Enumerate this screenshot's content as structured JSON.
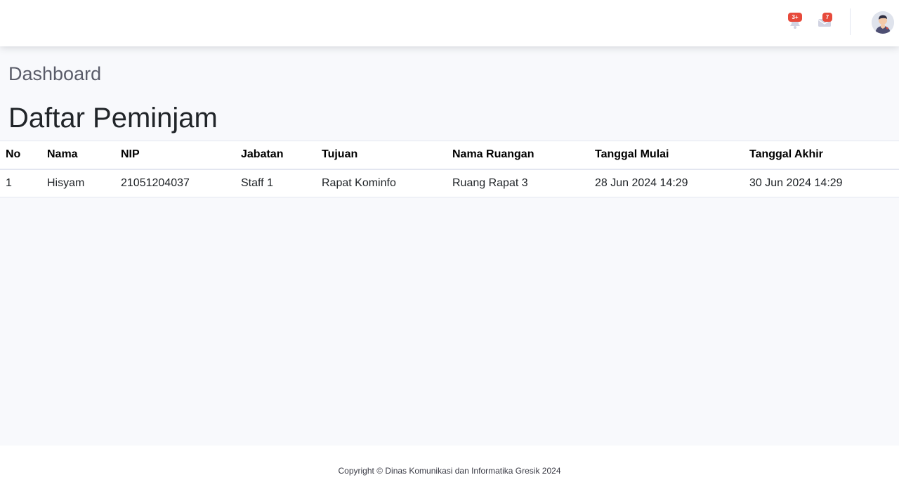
{
  "topbar": {
    "alerts_badge": "3+",
    "messages_badge": "7",
    "colors": {
      "badge": "#e74a3b",
      "icon": "#d1d3e2"
    }
  },
  "header": {
    "breadcrumb": "Dashboard",
    "title": "Daftar Peminjam"
  },
  "table": {
    "columns": [
      "No",
      "Nama",
      "NIP",
      "Jabatan",
      "Tujuan",
      "Nama Ruangan",
      "Tanggal Mulai",
      "Tanggal Akhir"
    ],
    "rows": [
      [
        "1",
        "Hisyam",
        "21051204037",
        "Staff 1",
        "Rapat Kominfo",
        "Ruang Rapat 3",
        "28 Jun 2024 14:29",
        "30 Jun 2024 14:29"
      ]
    ]
  },
  "footer": {
    "copyright": "Copyright © Dinas Komunikasi dan Informatika Gresik 2024"
  }
}
